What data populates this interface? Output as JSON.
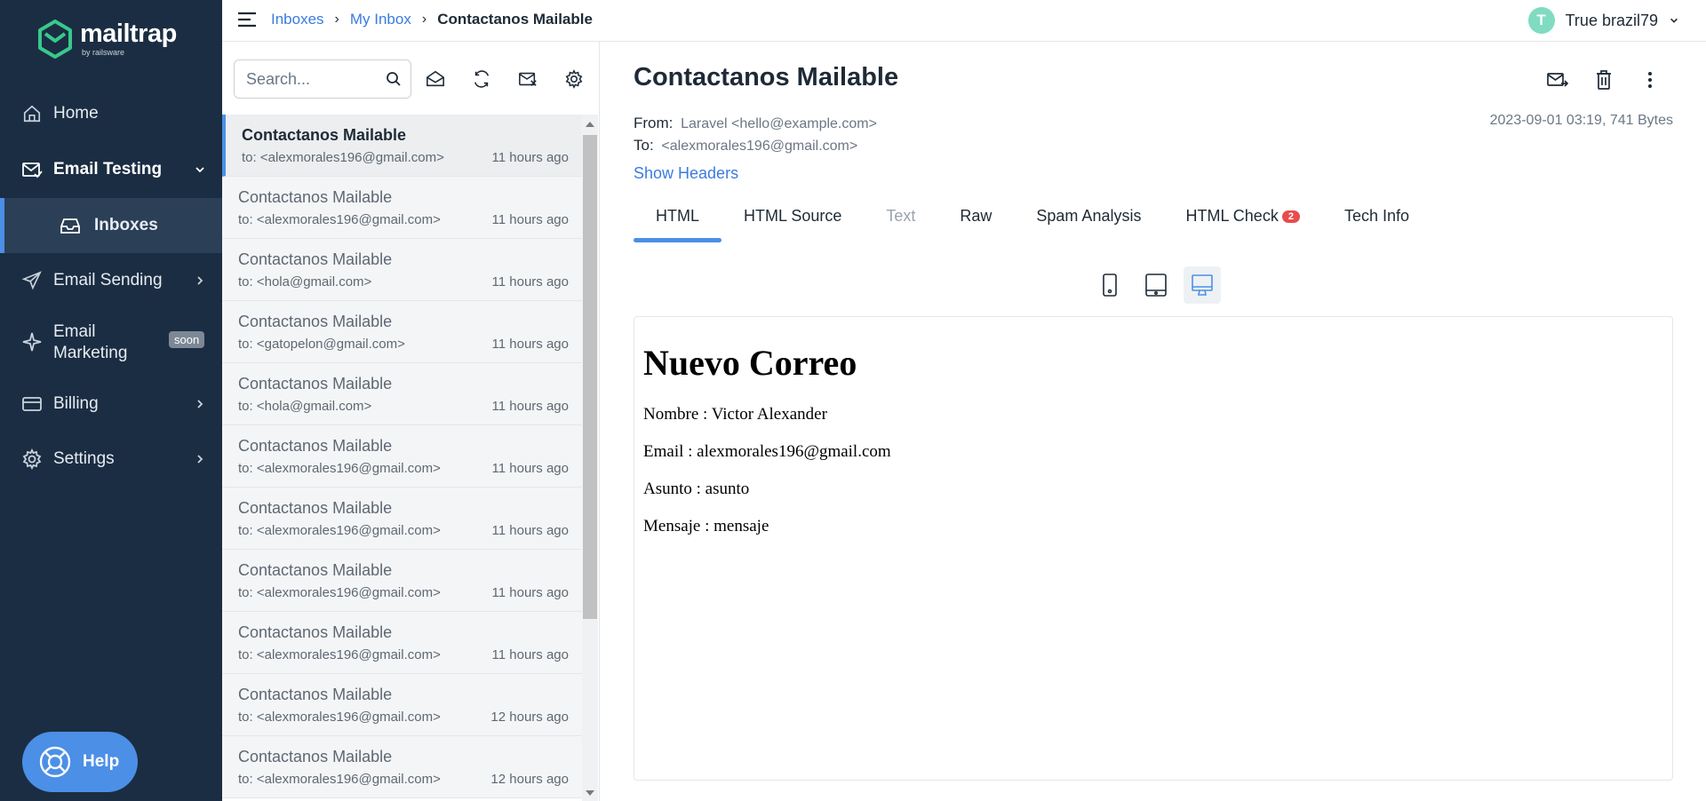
{
  "sidebar": {
    "logo": {
      "word": "mailtrap",
      "sub": "by railsware"
    },
    "items": [
      {
        "label": "Home",
        "icon": "home-icon"
      },
      {
        "label": "Email Testing",
        "icon": "email-testing-icon"
      },
      {
        "label": "Inboxes",
        "icon": "inbox-icon"
      },
      {
        "label": "Email Sending",
        "icon": "send-icon"
      },
      {
        "label": "Email Marketing",
        "icon": "sparkle-icon",
        "badge": "soon"
      },
      {
        "label": "Billing",
        "icon": "card-icon"
      },
      {
        "label": "Settings",
        "icon": "gear-icon"
      }
    ],
    "help_label": "Help"
  },
  "topbar": {
    "breadcrumb": [
      "Inboxes",
      "My Inbox",
      "Contactanos Mailable"
    ],
    "user_initial": "T",
    "user_name": "True brazil79"
  },
  "list": {
    "search_placeholder": "Search...",
    "messages": [
      {
        "subject": "Contactanos Mailable",
        "to": "to: <alexmorales196@gmail.com>",
        "time": "11 hours ago"
      },
      {
        "subject": "Contactanos Mailable",
        "to": "to: <alexmorales196@gmail.com>",
        "time": "11 hours ago"
      },
      {
        "subject": "Contactanos Mailable",
        "to": "to: <hola@gmail.com>",
        "time": "11 hours ago"
      },
      {
        "subject": "Contactanos Mailable",
        "to": "to: <gatopelon@gmail.com>",
        "time": "11 hours ago"
      },
      {
        "subject": "Contactanos Mailable",
        "to": "to: <hola@gmail.com>",
        "time": "11 hours ago"
      },
      {
        "subject": "Contactanos Mailable",
        "to": "to: <alexmorales196@gmail.com>",
        "time": "11 hours ago"
      },
      {
        "subject": "Contactanos Mailable",
        "to": "to: <alexmorales196@gmail.com>",
        "time": "11 hours ago"
      },
      {
        "subject": "Contactanos Mailable",
        "to": "to: <alexmorales196@gmail.com>",
        "time": "11 hours ago"
      },
      {
        "subject": "Contactanos Mailable",
        "to": "to: <alexmorales196@gmail.com>",
        "time": "11 hours ago"
      },
      {
        "subject": "Contactanos Mailable",
        "to": "to: <alexmorales196@gmail.com>",
        "time": "12 hours ago"
      },
      {
        "subject": "Contactanos Mailable",
        "to": "to: <alexmorales196@gmail.com>",
        "time": "12 hours ago"
      }
    ]
  },
  "detail": {
    "title": "Contactanos Mailable",
    "from_label": "From:",
    "from_value": "Laravel <hello@example.com>",
    "to_label": "To:",
    "to_value": "<alexmorales196@gmail.com>",
    "date_size": "2023-09-01 03:19, 741 Bytes",
    "show_headers": "Show Headers",
    "tabs": [
      {
        "label": "HTML"
      },
      {
        "label": "HTML Source"
      },
      {
        "label": "Text"
      },
      {
        "label": "Raw"
      },
      {
        "label": "Spam Analysis"
      },
      {
        "label": "HTML Check",
        "badge": "2"
      },
      {
        "label": "Tech Info"
      }
    ],
    "email_body": {
      "heading": "Nuevo Correo",
      "lines": [
        "Nombre : Victor Alexander",
        "Email : alexmorales196@gmail.com",
        "Asunto : asunto",
        "Mensaje : mensaje"
      ]
    }
  },
  "colors": {
    "sidebar_bg": "#1b2d42",
    "accent": "#4c8fe6",
    "link": "#3b7be0",
    "badge_red": "#e84c4c",
    "logo_green": "#37c98b"
  }
}
